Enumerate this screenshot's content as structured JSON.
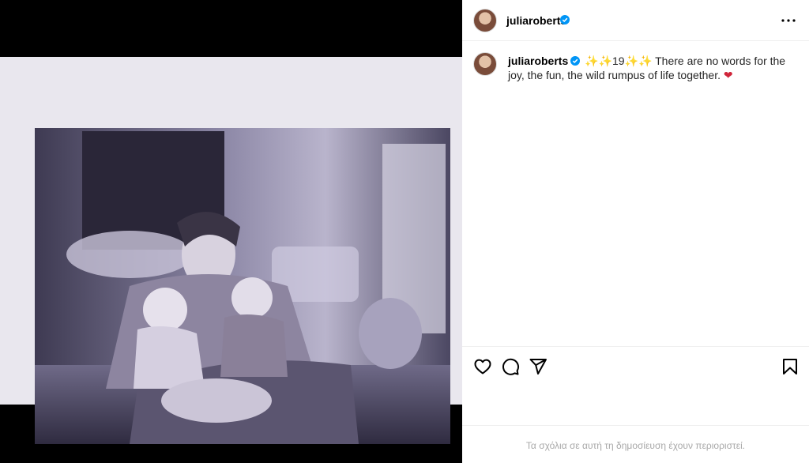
{
  "post": {
    "username": "juliaroberts",
    "verified": true,
    "caption": {
      "emoji_prefix": "✨✨",
      "number": "19",
      "emoji_suffix": "✨✨",
      "text": " There are no words for the joy, the fun, the wild rumpus of life together. ",
      "emoji_end": "❤"
    }
  },
  "header": {
    "more_icon": "more-horizontal-icon"
  },
  "actions": {
    "like_icon": "heart-icon",
    "comment_icon": "comment-icon",
    "share_icon": "send-icon",
    "save_icon": "bookmark-icon"
  },
  "footer": {
    "comments_notice": "Τα σχόλια σε αυτή τη δημοσίευση έχουν περιοριστεί."
  },
  "colors": {
    "verified": "#0095f6",
    "muted_text": "#a8a8a8",
    "divider": "#efefef",
    "media_background": "#000000"
  }
}
